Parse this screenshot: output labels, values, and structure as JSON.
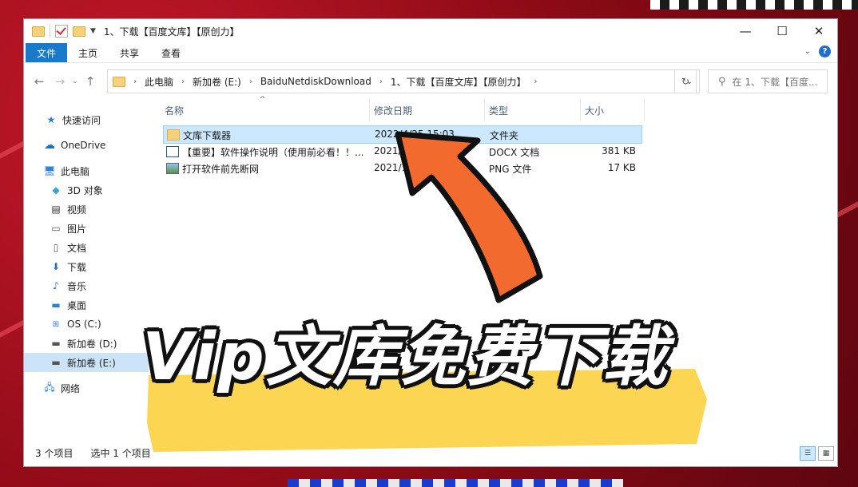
{
  "window": {
    "title": "1、下载【百度文库】【原创力】",
    "controls": {
      "minimize": "—",
      "maximize": "☐",
      "close": "✕"
    }
  },
  "ribbon": {
    "tabs": [
      "文件",
      "主页",
      "共享",
      "查看"
    ]
  },
  "address": {
    "crumbs": [
      "此电脑",
      "新加卷 (E:)",
      "BaiduNetdiskDownload",
      "1、下载【百度文库】【原创力】"
    ],
    "search_placeholder": "在 1、下载【百度..."
  },
  "nav": {
    "quick_access": "快速访问",
    "onedrive": "OneDrive",
    "this_pc": "此电脑",
    "pc_items": [
      "3D 对象",
      "视频",
      "图片",
      "文档",
      "下载",
      "音乐",
      "桌面",
      "OS (C:)",
      "新加卷 (D:)",
      "新加卷 (E:)"
    ],
    "network": "网络"
  },
  "columns": {
    "name": "名称",
    "modified": "修改日期",
    "type": "类型",
    "size": "大小"
  },
  "files": [
    {
      "name": "文库下载器",
      "modified": "2022/4/25 15:03",
      "type": "文件夹",
      "size": ""
    },
    {
      "name": "【重要】软件操作说明（使用前必看！！...",
      "modified": "2021/11/",
      "type": "DOCX 文档",
      "size": "381 KB"
    },
    {
      "name": "打开软件前先断网",
      "modified": "2021/10/",
      "type": "PNG 文件",
      "size": "17 KB"
    }
  ],
  "status": {
    "count": "3 个项目",
    "selected": "选中 1 个项目"
  },
  "overlay": {
    "headline": "Vip文库免费下载"
  },
  "colors": {
    "accent": "#1979ca",
    "arrow": "#f26a2e",
    "highlight": "#fcd34a",
    "background": "#8b0b16"
  }
}
